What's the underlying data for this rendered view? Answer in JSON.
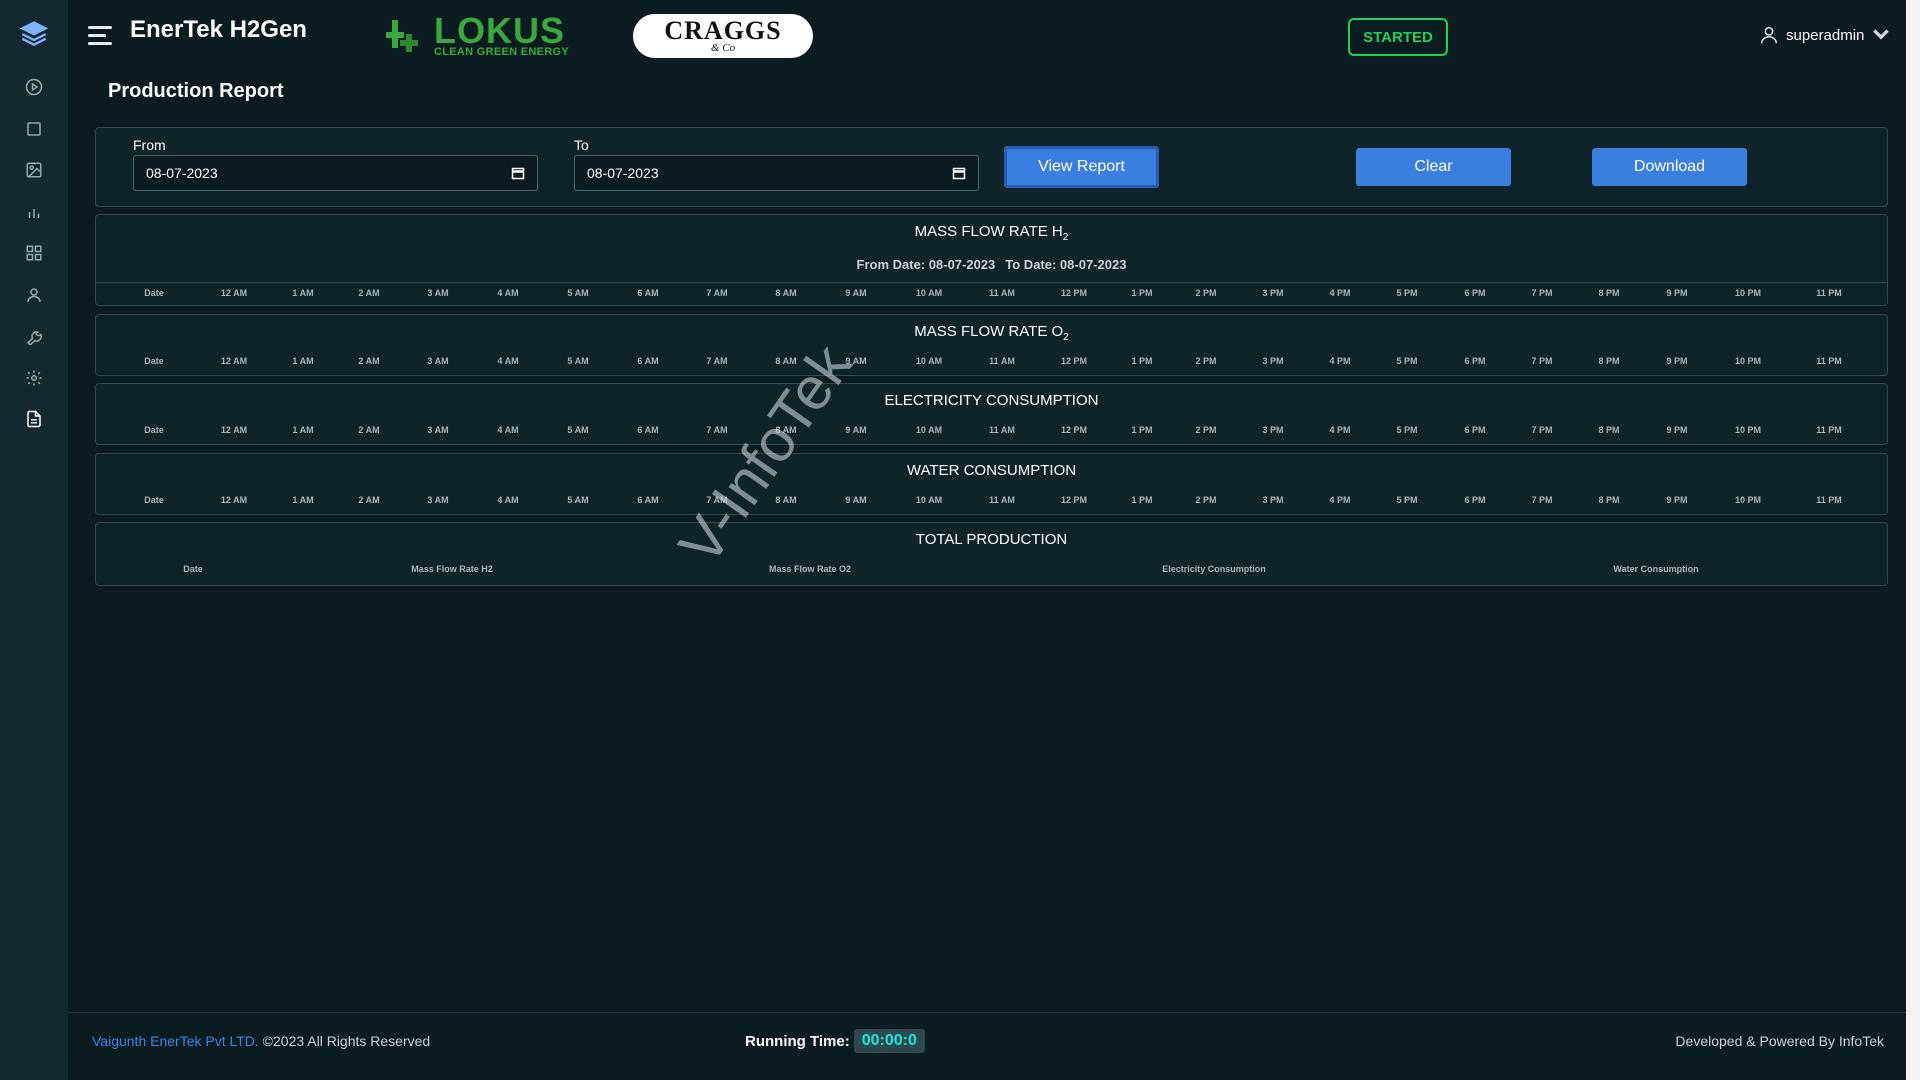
{
  "app": {
    "title": "EnerTek H2Gen"
  },
  "brand": {
    "lokus_name": "LOKUS",
    "lokus_tagline": "CLEAN GREEN ENERGY",
    "craggs_name": "CRAGGS",
    "craggs_sub": "& Co"
  },
  "header": {
    "status": "STARTED",
    "user": "superadmin"
  },
  "sidebar": {
    "items": [
      "layers-icon",
      "play-icon",
      "stop-icon",
      "image-icon",
      "chart-icon",
      "grid-icon",
      "user-icon",
      "wrench-icon",
      "settings-icon",
      "report-icon"
    ]
  },
  "page": {
    "title": "Production Report"
  },
  "filters": {
    "from_label": "From",
    "from_value": "08-07-2023",
    "to_label": "To",
    "to_value": "08-07-2023",
    "view_label": "View Report",
    "clear_label": "Clear",
    "download_label": "Download"
  },
  "sections": {
    "h2": {
      "title_main": "MASS FLOW RATE H",
      "title_sub": "2",
      "from_text": "From Date: 08-07-2023",
      "to_text": "To Date: 08-07-2023"
    },
    "o2": {
      "title_main": "MASS FLOW RATE O",
      "title_sub": "2"
    },
    "elec": {
      "title": "ELECTRICITY CONSUMPTION"
    },
    "water": {
      "title": "WATER CONSUMPTION"
    },
    "total": {
      "title": "TOTAL PRODUCTION"
    }
  },
  "hour_columns": [
    "Date",
    "12 AM",
    "1 AM",
    "2 AM",
    "3 AM",
    "4 AM",
    "5 AM",
    "6 AM",
    "7 AM",
    "8 AM",
    "9 AM",
    "10 AM",
    "11 AM",
    "12 PM",
    "1 PM",
    "2 PM",
    "3 PM",
    "4 PM",
    "5 PM",
    "6 PM",
    "7 PM",
    "8 PM",
    "9 PM",
    "10 PM",
    "11 PM"
  ],
  "total_columns": [
    "Date",
    "Mass Flow Rate H2",
    "Mass Flow Rate O2",
    "Electricity Consumption",
    "Water Consumption"
  ],
  "watermark": "V-InfoTek",
  "footer": {
    "company_link": "Vaigunth EnerTek Pvt LTD.",
    "copyright": " ©2023 All Rights Reserved",
    "running_label": "Running Time:",
    "running_value": "00:00:0",
    "powered": "Developed & Powered By InfoTek"
  },
  "colors": {
    "accent": "#3a7ee0",
    "status": "#1fd15c",
    "timer": "#1ee6d8",
    "background": "#0b1c21",
    "sidebar": "#13292f"
  }
}
